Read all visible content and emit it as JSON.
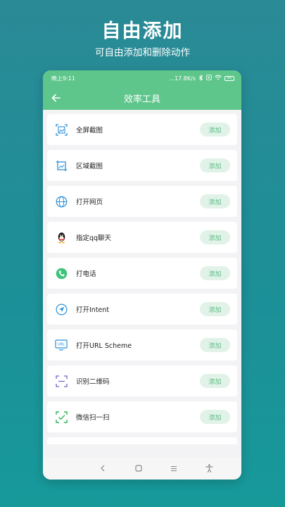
{
  "promo": {
    "title": "自由添加",
    "subtitle": "可自由添加和删除动作"
  },
  "status_bar": {
    "time": "晚上9:11",
    "speed": "...17.8K/s",
    "battery": "85"
  },
  "app_bar": {
    "title": "效率工具",
    "back_icon": "arrow-left-icon"
  },
  "add_label": "添加",
  "items": [
    {
      "label": "全屏截图",
      "icon": "fullscreen-screenshot-icon"
    },
    {
      "label": "区域截图",
      "icon": "region-screenshot-icon"
    },
    {
      "label": "打开网页",
      "icon": "globe-icon"
    },
    {
      "label": "指定qq聊天",
      "icon": "qq-penguin-icon"
    },
    {
      "label": "打电话",
      "icon": "phone-call-icon"
    },
    {
      "label": "打开Intent",
      "icon": "send-arrow-icon"
    },
    {
      "label": "打开URL Scheme",
      "icon": "url-monitor-icon"
    },
    {
      "label": "识别二维码",
      "icon": "qr-scan-frame-icon"
    },
    {
      "label": "微信扫一扫",
      "icon": "wechat-scan-icon"
    }
  ],
  "colors": {
    "accent": "#5fc68b",
    "add_button_bg": "#e1f3e8",
    "add_button_text": "#5bbb83"
  },
  "nav_bar": {
    "back_icon": "nav-back-icon",
    "home_icon": "nav-home-icon",
    "recents_icon": "nav-menu-icon",
    "accessibility_icon": "accessibility-icon"
  }
}
